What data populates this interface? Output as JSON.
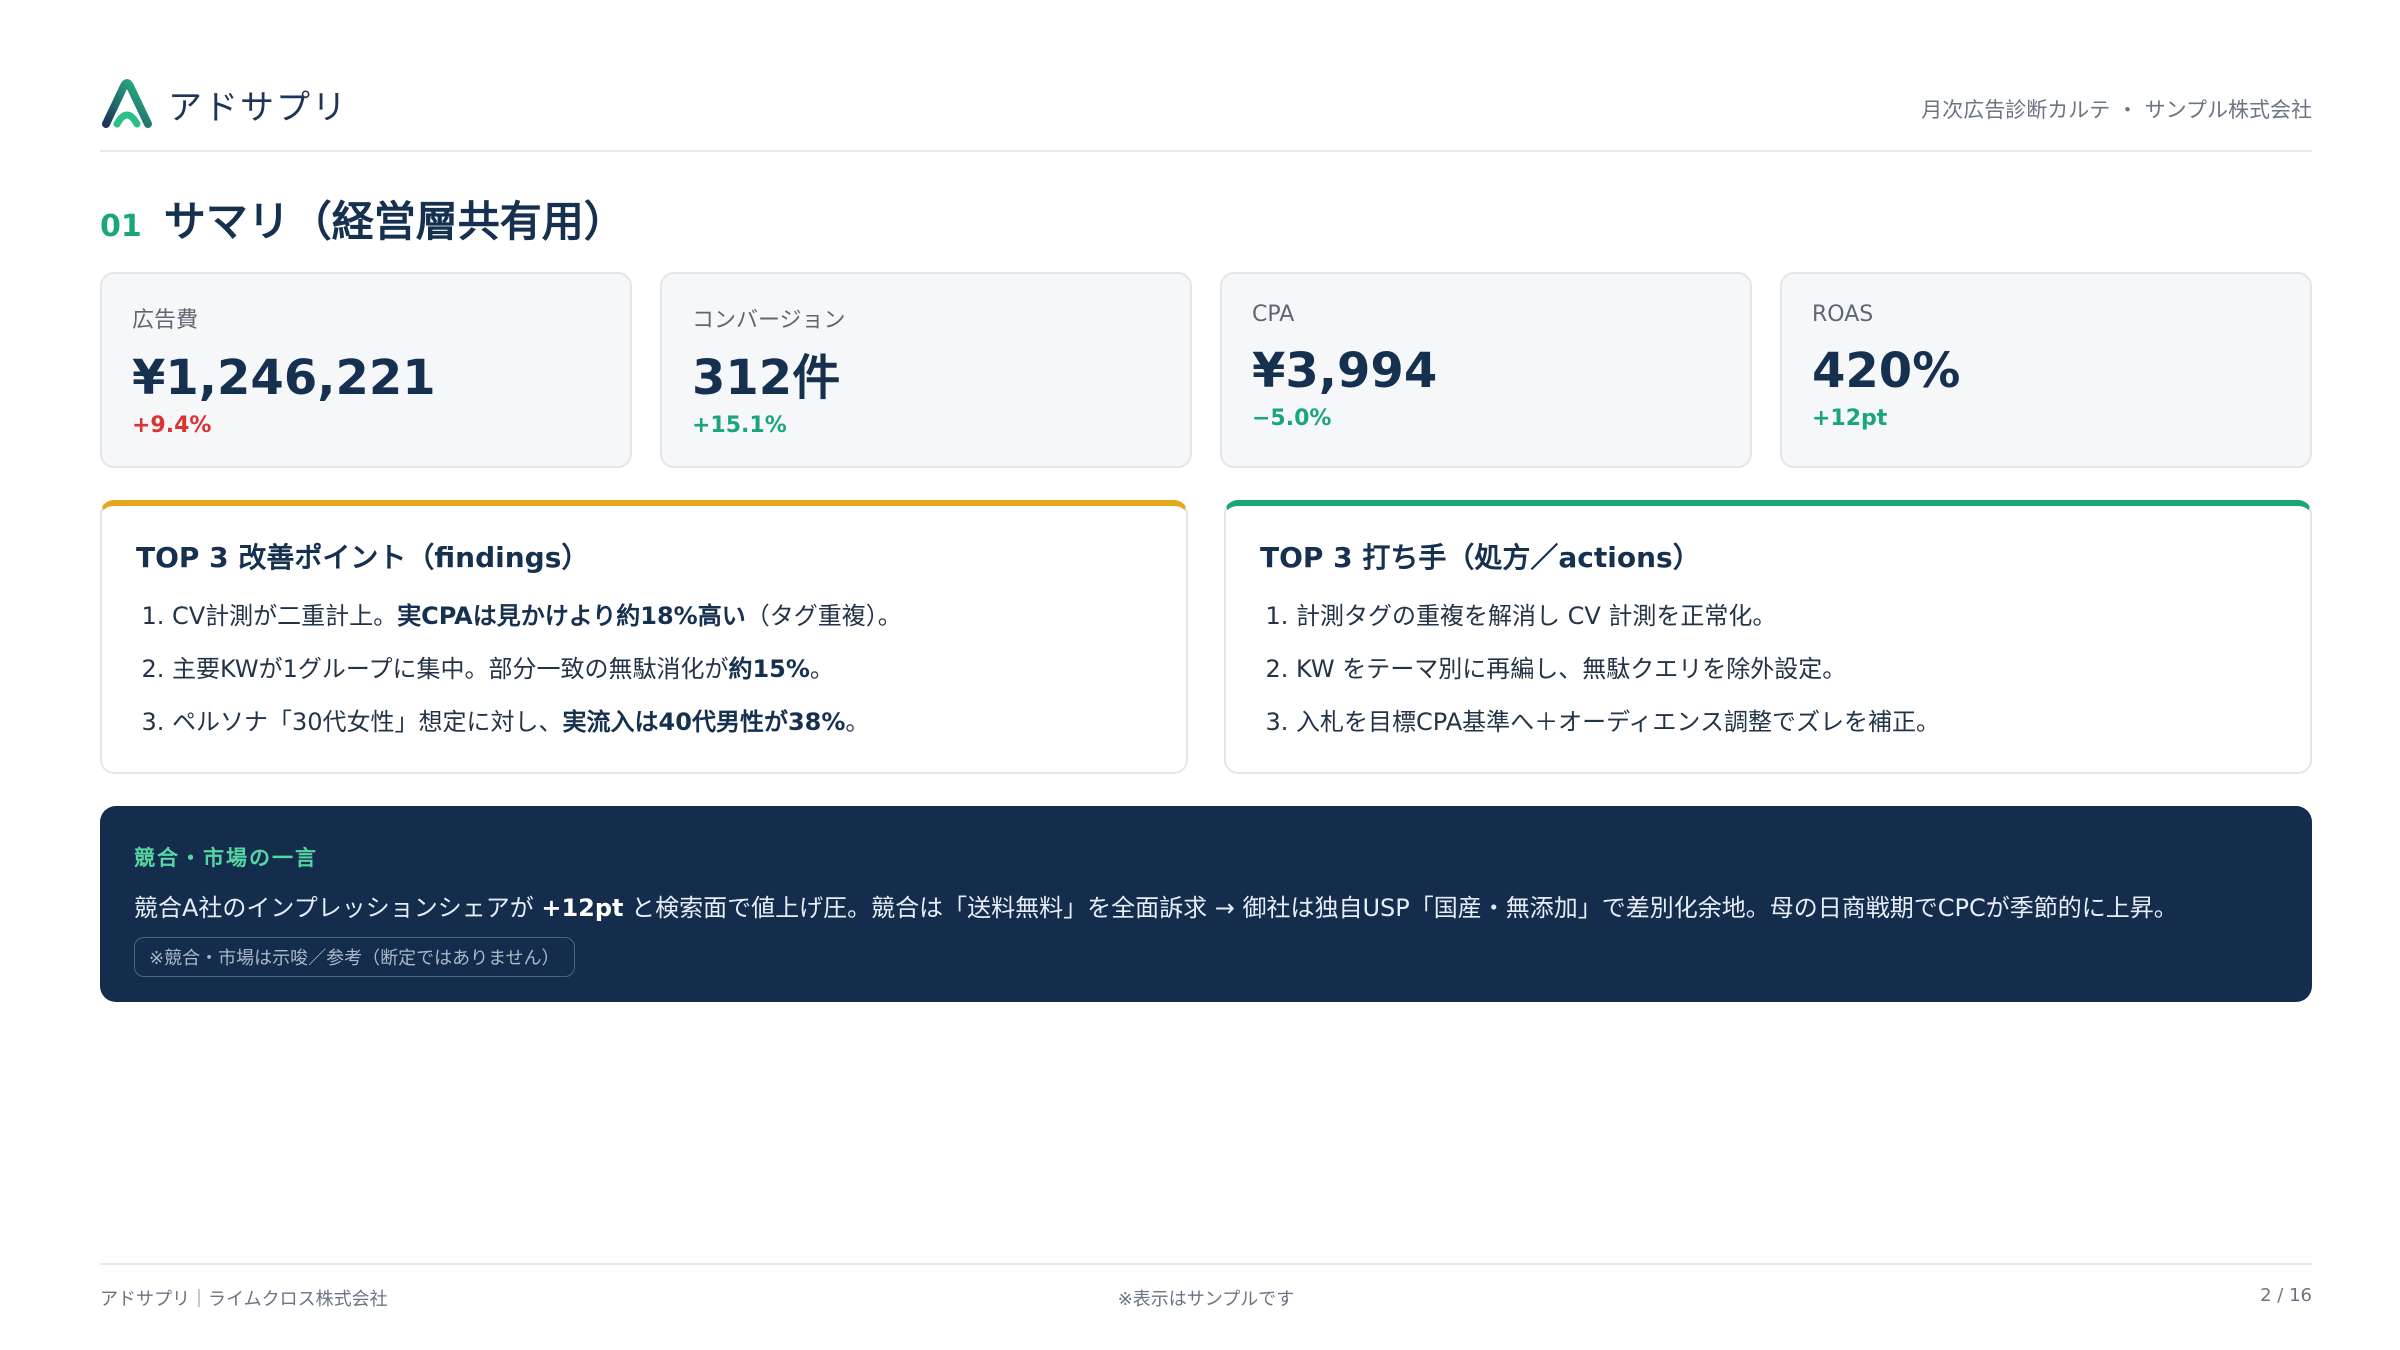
{
  "brand": {
    "name": "アドサプリ"
  },
  "header": {
    "doc_title": "月次広告診断カルテ ・ サンプル株式会社"
  },
  "section": {
    "number": "01",
    "title": "サマリ（経営層共有用）"
  },
  "kpis": [
    {
      "label": "広告費",
      "value": "¥1,246,221",
      "delta": "+9.4%",
      "delta_color": "#d93434"
    },
    {
      "label": "コンバージョン",
      "value": "312件",
      "delta": "+15.1%",
      "delta_color": "#1aa67a"
    },
    {
      "label": "CPA",
      "value": "¥3,994",
      "delta": "−5.0%",
      "delta_color": "#1aa67a"
    },
    {
      "label": "ROAS",
      "value": "420%",
      "delta": "+12pt",
      "delta_color": "#1aa67a"
    }
  ],
  "findings": {
    "title": "TOP 3 改善ポイント（findings）",
    "accent": "#e3a91b",
    "items": [
      {
        "pre": "CV計測が二重計上。",
        "bold": "実CPAは見かけより約18%高い",
        "post": "（タグ重複）。"
      },
      {
        "pre": "主要KWが1グループに集中。部分一致の無駄消化が",
        "bold": "約15%",
        "post": "。"
      },
      {
        "pre": "ペルソナ「30代女性」想定に対し、",
        "bold": "実流入は40代男性が38%",
        "post": "。"
      }
    ]
  },
  "actions": {
    "title": "TOP 3 打ち手（処方／actions）",
    "accent": "#1aa67a",
    "items": [
      "計測タグの重複を解消し CV 計測を正常化。",
      "KW をテーマ別に再編し、無駄クエリを除外設定。",
      "入札を目標CPA基準へ＋オーディエンス調整でズレを補正。"
    ]
  },
  "market": {
    "title": "競合・市場の一言",
    "text_pre": "競合A社のインプレッションシェアが ",
    "text_bold": "+12pt",
    "text_post": " と検索面で値上げ圧。競合は「送料無料」を全面訴求 → 御社は独自USP「国産・無添加」で差別化余地。母の日商戦期でCPCが季節的に上昇。",
    "note": "※競合・市場は示唆／参考（断定ではありません）"
  },
  "footer": {
    "left": "アドサプリ｜ライムクロス株式会社",
    "center": "※表示はサンプルです",
    "right": "2 / 16"
  },
  "colors": {
    "navy": "#16304f",
    "green": "#1aa67a",
    "red": "#d93434",
    "amber": "#e3a91b",
    "panel": "#142d4d"
  }
}
